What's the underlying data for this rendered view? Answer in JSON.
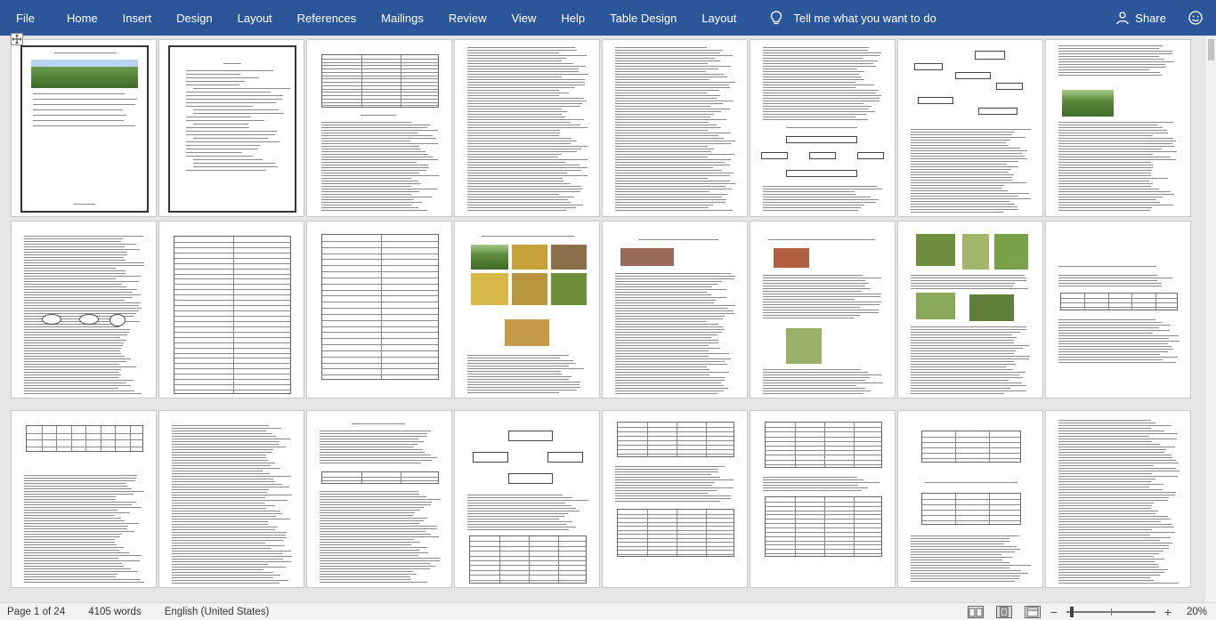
{
  "ribbon": {
    "tabs": [
      {
        "label": "File",
        "name": "tab-file"
      },
      {
        "label": "Home",
        "name": "tab-home"
      },
      {
        "label": "Insert",
        "name": "tab-insert"
      },
      {
        "label": "Design",
        "name": "tab-design"
      },
      {
        "label": "Layout",
        "name": "tab-layout"
      },
      {
        "label": "References",
        "name": "tab-references"
      },
      {
        "label": "Mailings",
        "name": "tab-mailings"
      },
      {
        "label": "Review",
        "name": "tab-review"
      },
      {
        "label": "View",
        "name": "tab-view"
      },
      {
        "label": "Help",
        "name": "tab-help"
      },
      {
        "label": "Table Design",
        "name": "tab-table-design"
      },
      {
        "label": "Layout",
        "name": "tab-table-layout"
      }
    ],
    "tell_me": "Tell me what you want to do",
    "share": "Share",
    "colors": {
      "ribbon_bg": "#2b579a",
      "ribbon_text": "#ffffff"
    }
  },
  "status": {
    "page": "Page 1 of 24",
    "words": "4105 words",
    "language": "English (United States)",
    "zoom": "20%",
    "zoom_level": 20
  },
  "icons": {
    "tell_me": "lightbulb-icon",
    "share": "person-icon",
    "move_handle": "move-handle-icon"
  }
}
